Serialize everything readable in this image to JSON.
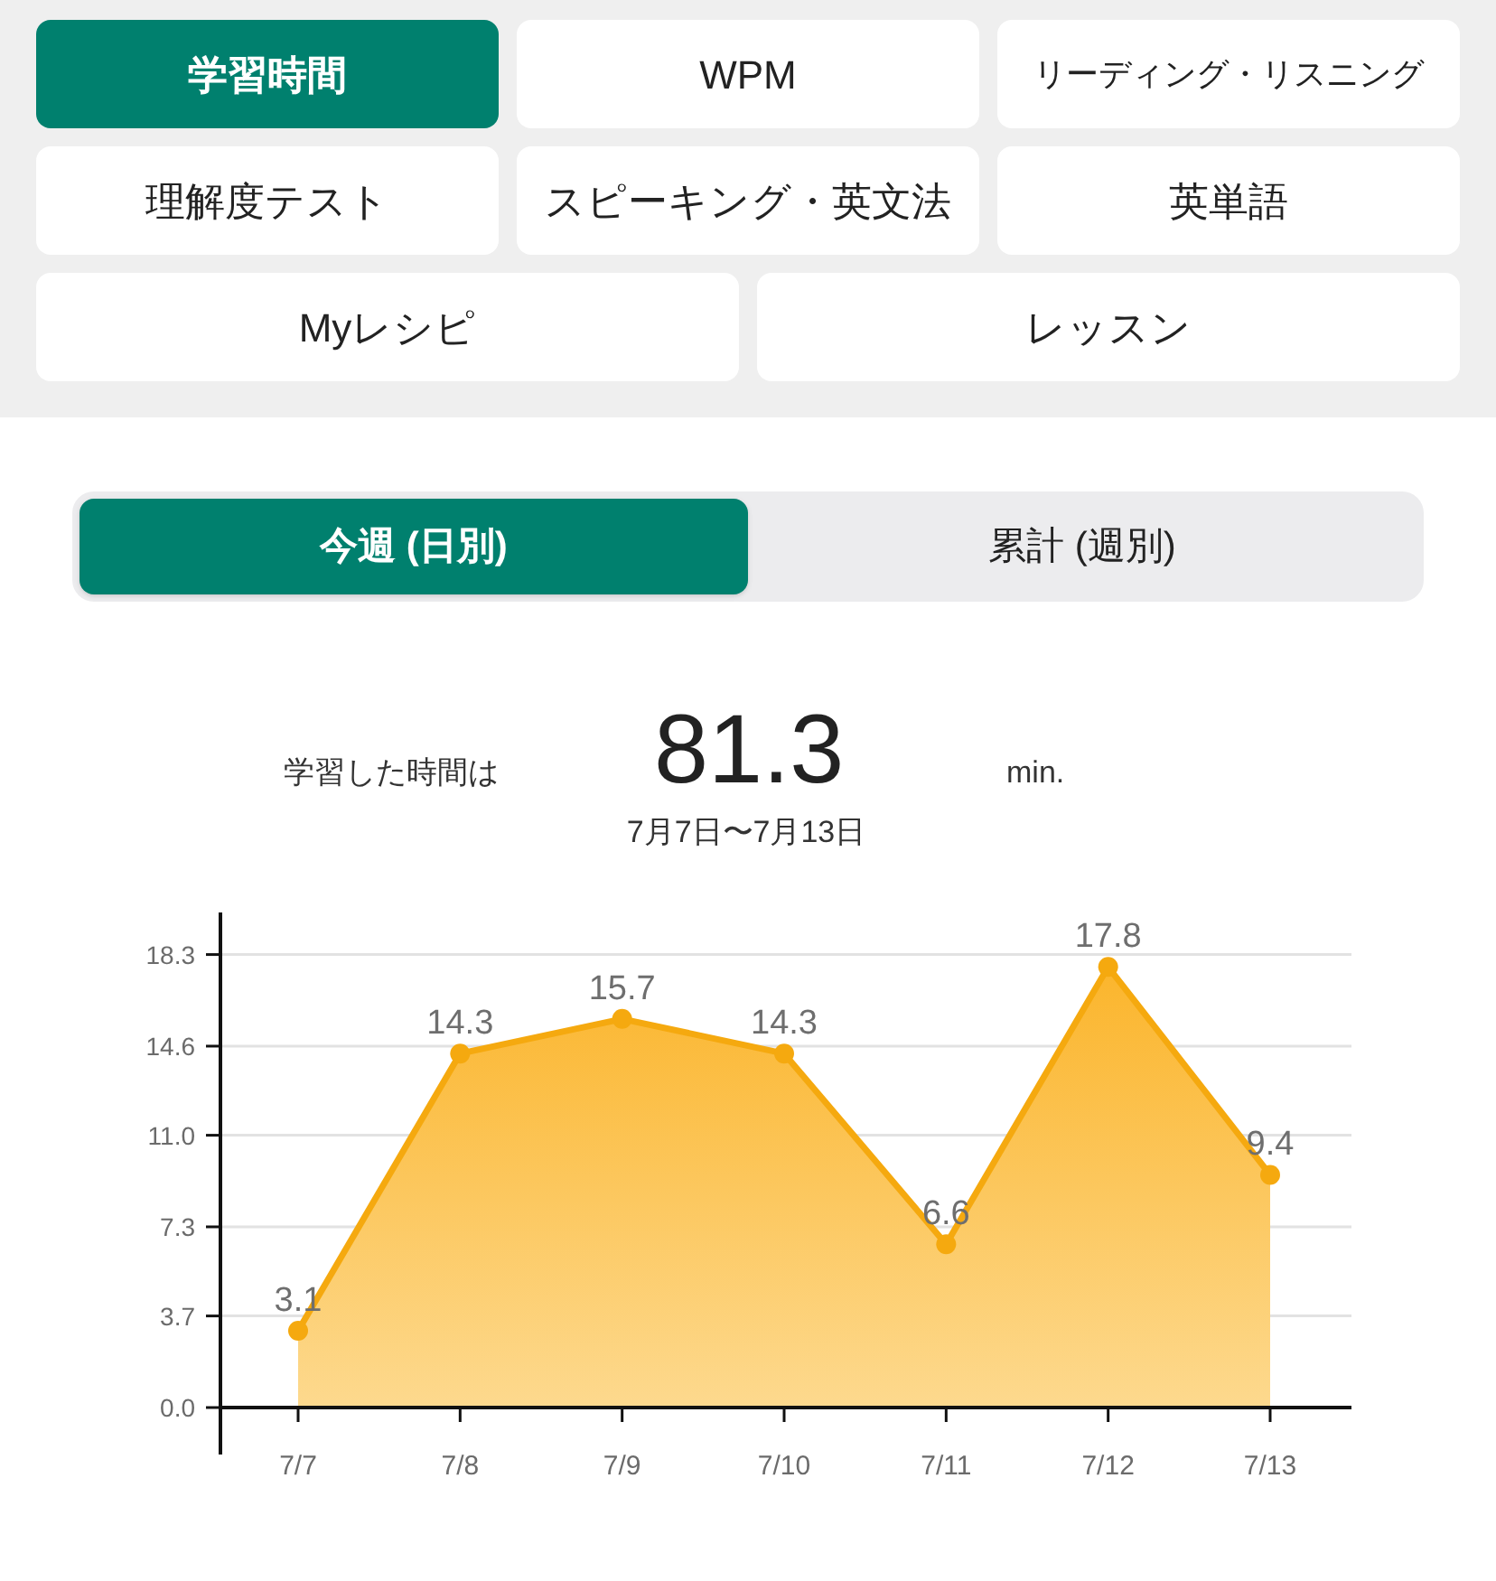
{
  "category_tabs": [
    [
      {
        "label": "学習時間",
        "selected": true
      },
      {
        "label": "WPM",
        "selected": false
      },
      {
        "label": "リーディング・リスニング",
        "selected": false
      }
    ],
    [
      {
        "label": "理解度テスト",
        "selected": false
      },
      {
        "label": "スピーキング・英文法",
        "selected": false
      },
      {
        "label": "英単語",
        "selected": false
      }
    ],
    [
      {
        "label": "Myレシピ",
        "selected": false
      },
      {
        "label": "レッスン",
        "selected": false
      }
    ]
  ],
  "period_tabs": [
    {
      "label": "今週 (日別)",
      "selected": true
    },
    {
      "label": "累計 (週別)",
      "selected": false
    }
  ],
  "summary": {
    "label": "学習した時間は",
    "value": "81.3",
    "unit": "min.",
    "date_range": "7月7日〜7月13日"
  },
  "chart_data": {
    "type": "area",
    "categories": [
      "7/7",
      "7/8",
      "7/9",
      "7/10",
      "7/11",
      "7/12",
      "7/13"
    ],
    "values": [
      3.1,
      14.3,
      15.7,
      14.3,
      6.6,
      17.8,
      9.4
    ],
    "ylim": [
      0,
      20
    ],
    "yticks": [
      {
        "value": 0,
        "label": "0.0"
      },
      3.7,
      7.3,
      {
        "value": 11,
        "label": "11.0"
      },
      14.6,
      18.3
    ],
    "data_labels": true,
    "grid": true
  }
}
